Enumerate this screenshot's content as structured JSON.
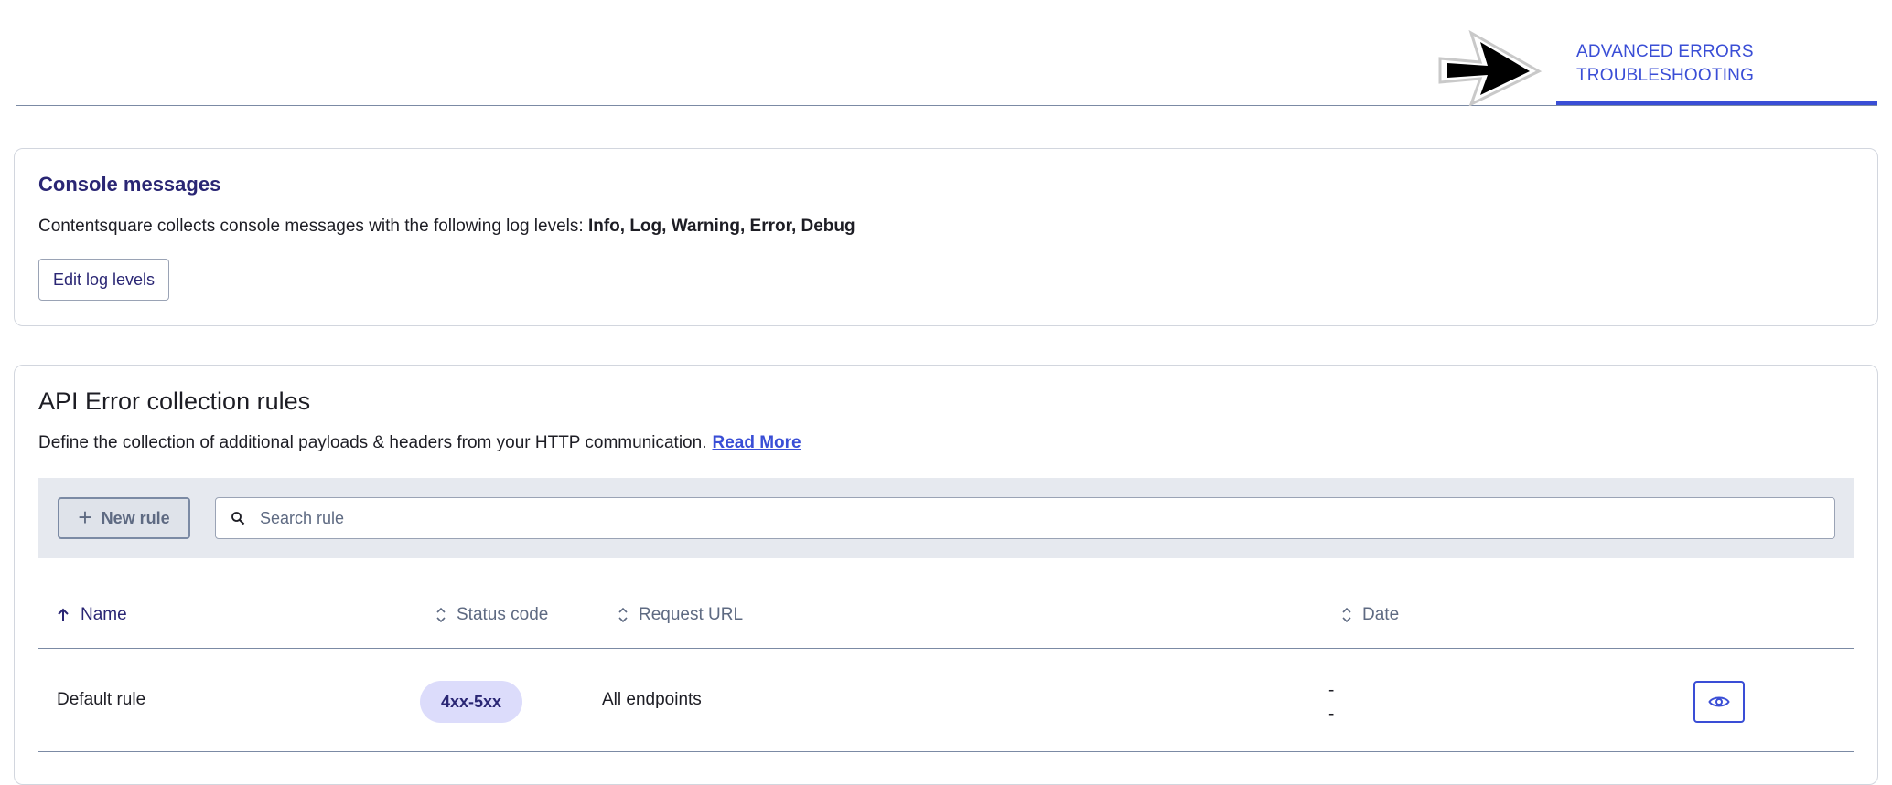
{
  "tabs": {
    "active_label": "ADVANCED ERRORS TROUBLESHOOTING"
  },
  "console": {
    "title": "Console messages",
    "description_prefix": "Contentsquare collects console messages with the following log levels: ",
    "log_levels": "Info, Log, Warning, Error, Debug",
    "edit_button": "Edit log levels"
  },
  "api": {
    "title": "API Error collection rules",
    "description": "Define the collection of additional payloads & headers from your HTTP communication.",
    "read_more": "Read More",
    "new_rule_button": "New rule",
    "search_placeholder": "Search rule",
    "columns": {
      "name": "Name",
      "status_code": "Status code",
      "request_url": "Request URL",
      "date": "Date"
    },
    "rows": [
      {
        "name": "Default rule",
        "status_code": "4xx-5xx",
        "request_url": "All endpoints",
        "date_line1": "-",
        "date_line2": "-"
      }
    ]
  },
  "colors": {
    "accent": "#3a4ed6",
    "heading": "#2a2674",
    "badge_bg": "#dcdcfb",
    "toolbar_bg": "#e6e9ef"
  },
  "icons": {
    "pointer": "arrow-pointer-icon",
    "add": "plus-icon",
    "search": "search-icon",
    "sort_asc": "arrow-up-icon",
    "sort": "sort-icon",
    "view": "eye-icon"
  }
}
